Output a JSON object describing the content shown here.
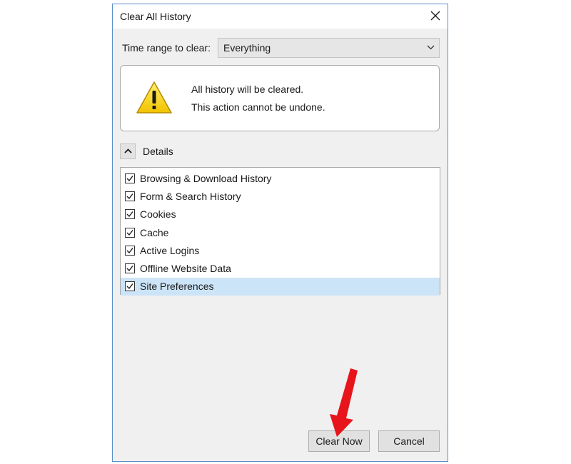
{
  "dialog": {
    "title": "Clear All History",
    "close_icon": "close-icon"
  },
  "time_range": {
    "label": "Time range to clear:",
    "selected": "Everything"
  },
  "warning": {
    "icon": "warning-icon",
    "line1": "All history will be cleared.",
    "line2": "This action cannot be undone."
  },
  "details": {
    "label": "Details",
    "expanded": true,
    "items": [
      {
        "label": "Browsing & Download History",
        "checked": true
      },
      {
        "label": "Form & Search History",
        "checked": true
      },
      {
        "label": "Cookies",
        "checked": true
      },
      {
        "label": "Cache",
        "checked": true
      },
      {
        "label": "Active Logins",
        "checked": true
      },
      {
        "label": "Offline Website Data",
        "checked": true
      },
      {
        "label": "Site Preferences",
        "checked": true,
        "selected": true
      }
    ]
  },
  "buttons": {
    "clear_now": "Clear Now",
    "cancel": "Cancel"
  },
  "colors": {
    "dialog_border": "#5a8fc9",
    "selection": "#cce4f7",
    "annotation_arrow": "#e8141b"
  }
}
